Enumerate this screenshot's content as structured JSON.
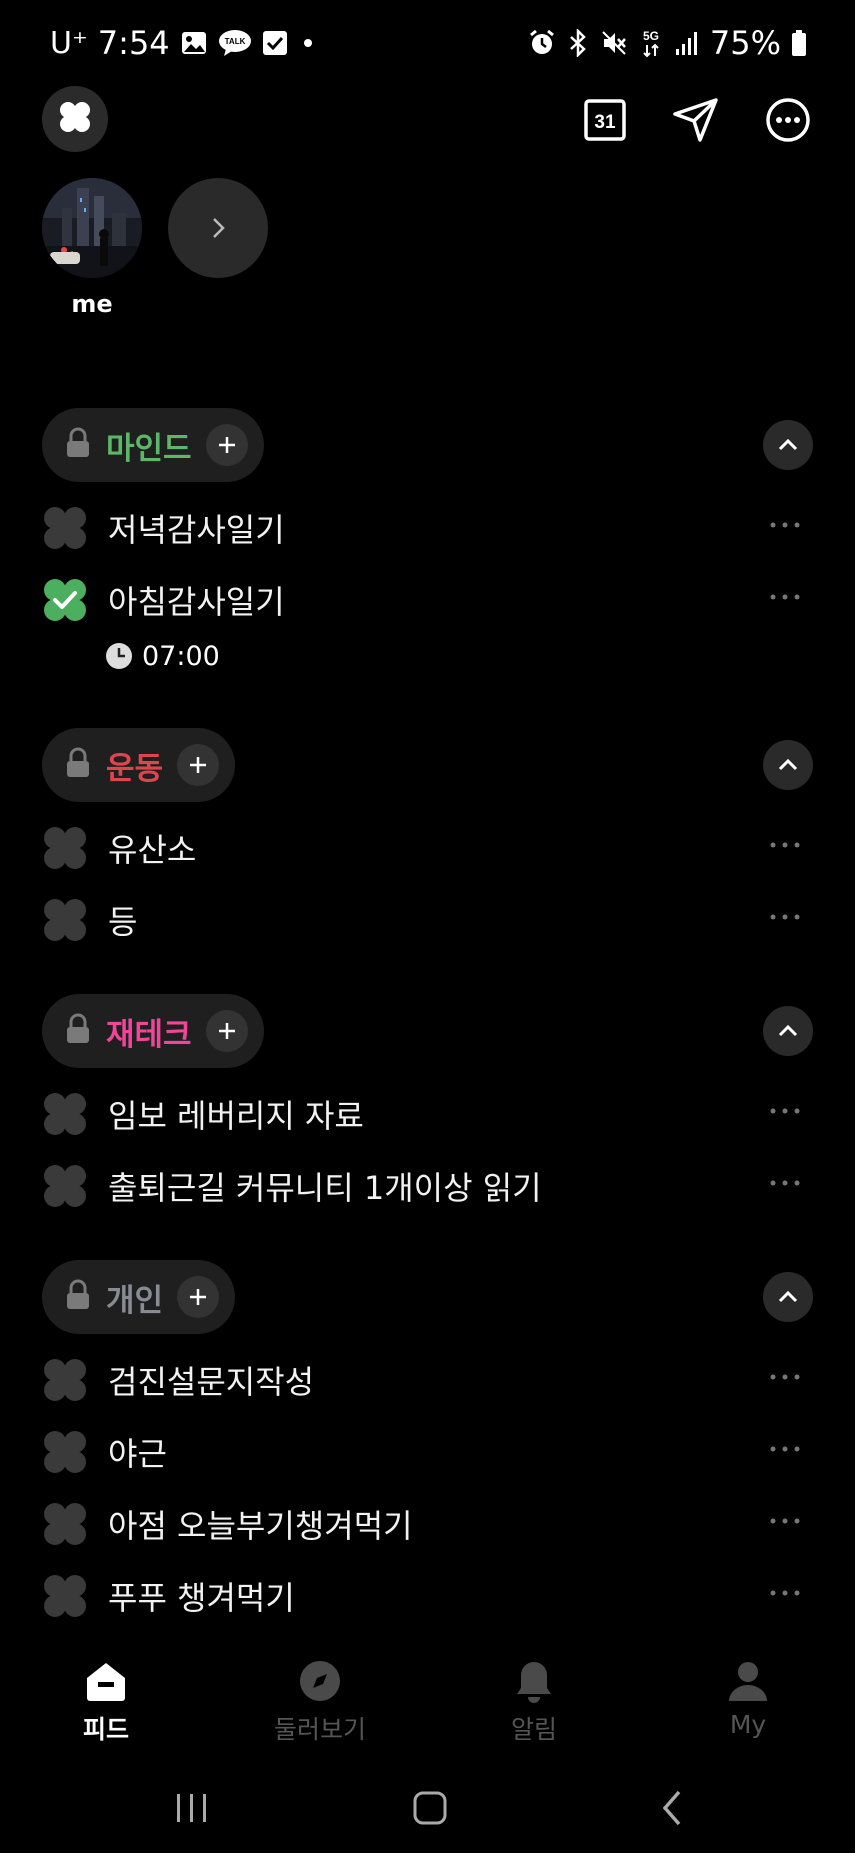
{
  "status_bar": {
    "carrier": "U⁺",
    "time": "7:54",
    "battery": "75%",
    "left_icons": [
      "gallery-icon",
      "talk-icon",
      "checkbox-icon",
      "dot-icon"
    ],
    "right_icons": [
      "alarm-icon",
      "bluetooth-icon",
      "mute-icon",
      "5g-icon",
      "signal-icon",
      "battery-icon"
    ],
    "talk_text": "TALK",
    "fiveg_text": "5G"
  },
  "top_bar": {
    "calendar_text": "31"
  },
  "stories": {
    "me_label": "me"
  },
  "categories": [
    {
      "name": "마인드",
      "color": "#5cb868",
      "tasks": [
        {
          "title": "저녁감사일기",
          "done": false
        },
        {
          "title": "아침감사일기",
          "done": true,
          "time": "07:00"
        }
      ]
    },
    {
      "name": "운동",
      "color": "#e0454f",
      "tasks": [
        {
          "title": "유산소",
          "done": false
        },
        {
          "title": "등",
          "done": false
        }
      ]
    },
    {
      "name": "재테크",
      "color": "#f0459a",
      "tasks": [
        {
          "title": "임보 레버리지 자료",
          "done": false
        },
        {
          "title": "출퇴근길 커뮤니티 1개이상 읽기",
          "done": false
        }
      ]
    },
    {
      "name": "개인",
      "color": "#8a8a95",
      "tasks": [
        {
          "title": "검진설문지작성",
          "done": false
        },
        {
          "title": "야근",
          "done": false
        },
        {
          "title": "아점 오늘부기챙겨먹기",
          "done": false
        },
        {
          "title": "푸푸 챙겨먹기",
          "done": false
        }
      ]
    }
  ],
  "colors": {
    "accent_check": "#4caf5f",
    "empty_check": "#3a3a3a"
  },
  "bottom_nav": {
    "items": [
      {
        "label": "피드",
        "icon": "home-icon",
        "active": true
      },
      {
        "label": "둘러보기",
        "icon": "compass-icon",
        "active": false
      },
      {
        "label": "알림",
        "icon": "bell-icon",
        "active": false
      },
      {
        "label": "My",
        "icon": "profile-icon",
        "active": false
      }
    ]
  }
}
